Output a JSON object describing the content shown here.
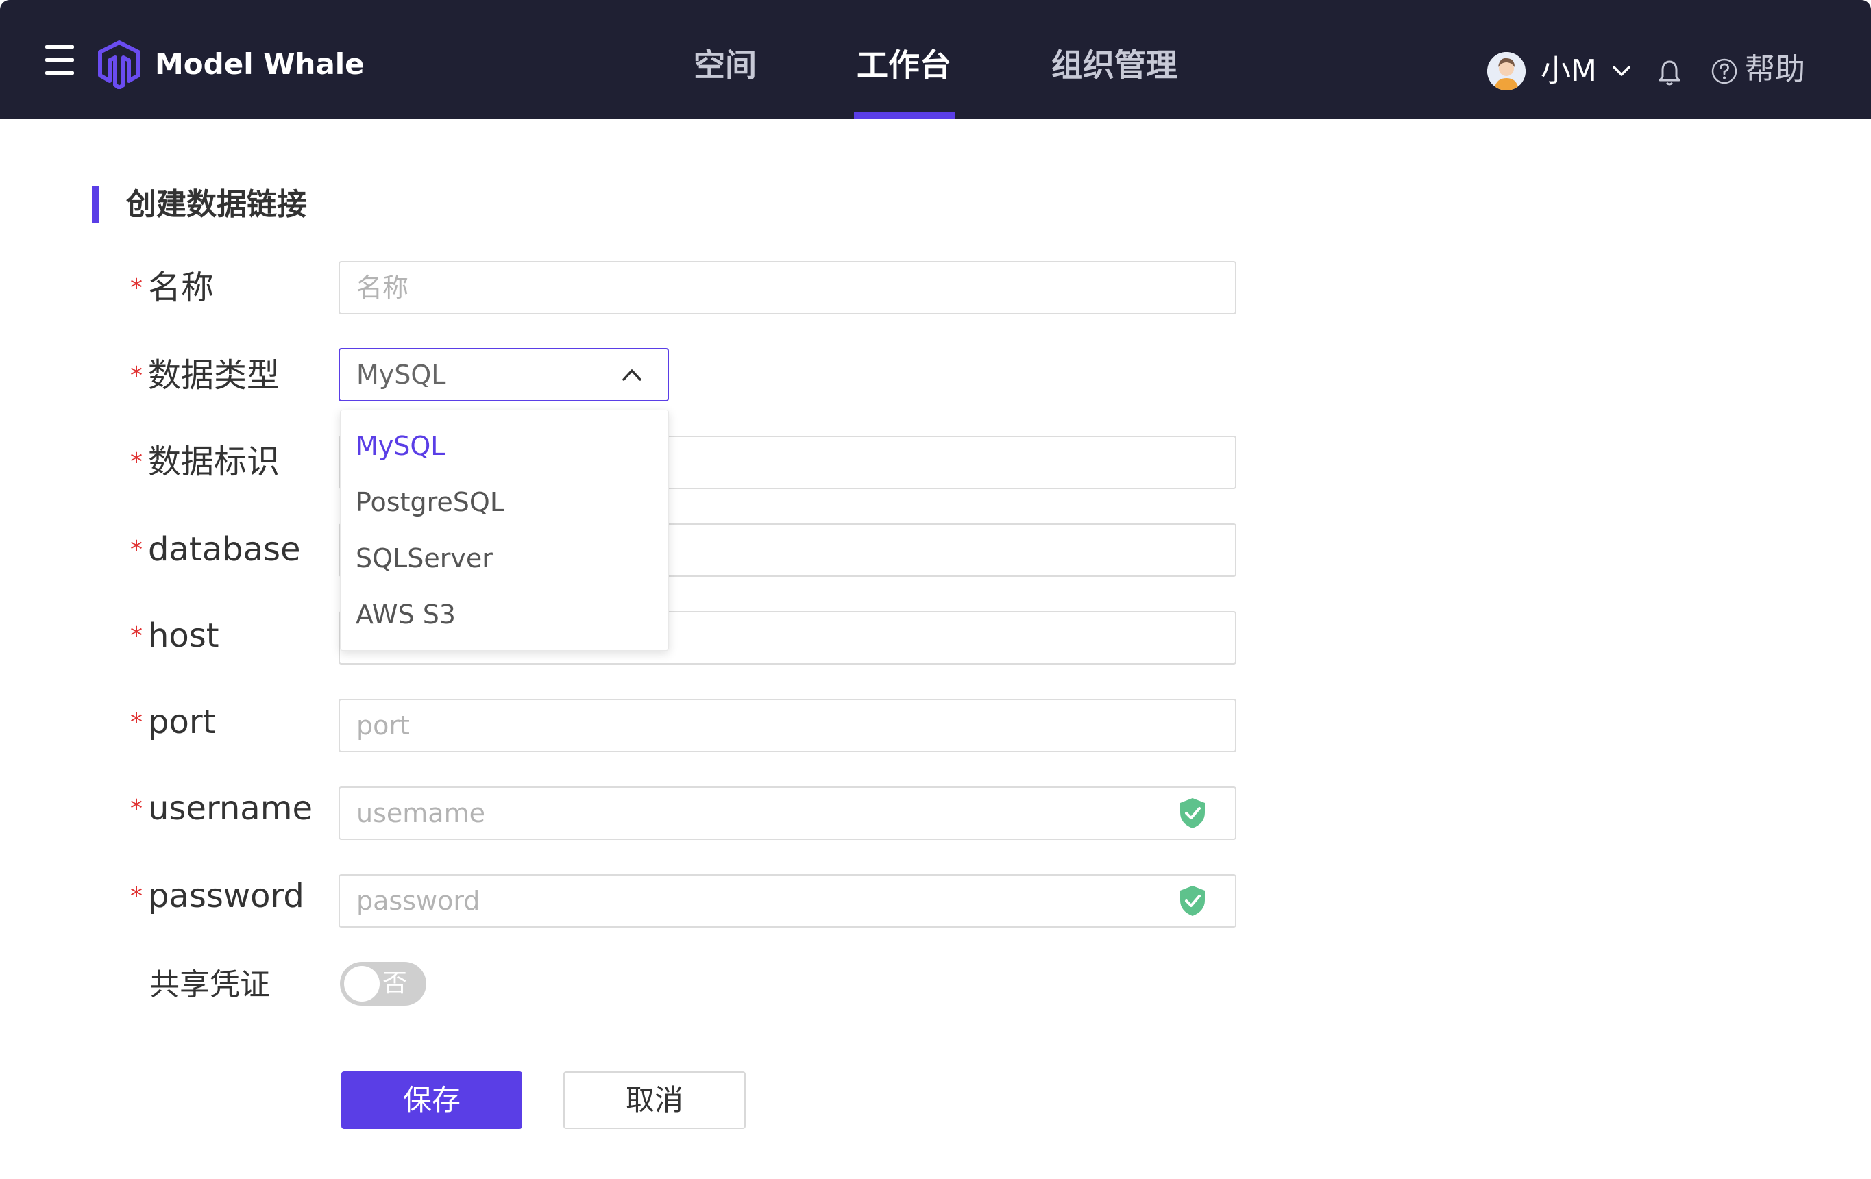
{
  "header": {
    "brand": "Model Whale",
    "tabs": [
      {
        "label": "空间",
        "active": false
      },
      {
        "label": "工作台",
        "active": true
      },
      {
        "label": "组织管理",
        "active": false
      }
    ],
    "user_name": "小M",
    "help_label": "帮助",
    "accent_color": "#5a3ee6",
    "background_color": "#1f2033"
  },
  "page": {
    "title": "创建数据链接"
  },
  "form": {
    "name": {
      "label": "名称",
      "placeholder": "名称",
      "required": true
    },
    "data_type": {
      "label": "数据类型",
      "value": "MySQL",
      "required": true,
      "options": [
        "MySQL",
        "PostgreSQL",
        "SQLServer",
        "AWS S3"
      ],
      "selected_option": "MySQL"
    },
    "data_identifier": {
      "label": "数据标识",
      "required": true
    },
    "database": {
      "label": "database",
      "required": true
    },
    "host": {
      "label": "host",
      "required": true
    },
    "port": {
      "label": "port",
      "placeholder": "port",
      "required": true
    },
    "username": {
      "label": "username",
      "placeholder": "usemame",
      "required": true,
      "icon": "shield-check-icon"
    },
    "password": {
      "label": "password",
      "placeholder": "password",
      "required": true,
      "icon": "shield-check-icon"
    },
    "share_credentials": {
      "label": "共享凭证",
      "toggle_text": "否",
      "value": false
    }
  },
  "actions": {
    "save_label": "保存",
    "cancel_label": "取消"
  },
  "colors": {
    "required_mark": "#e03131",
    "shield_green": "#5ec28c"
  }
}
